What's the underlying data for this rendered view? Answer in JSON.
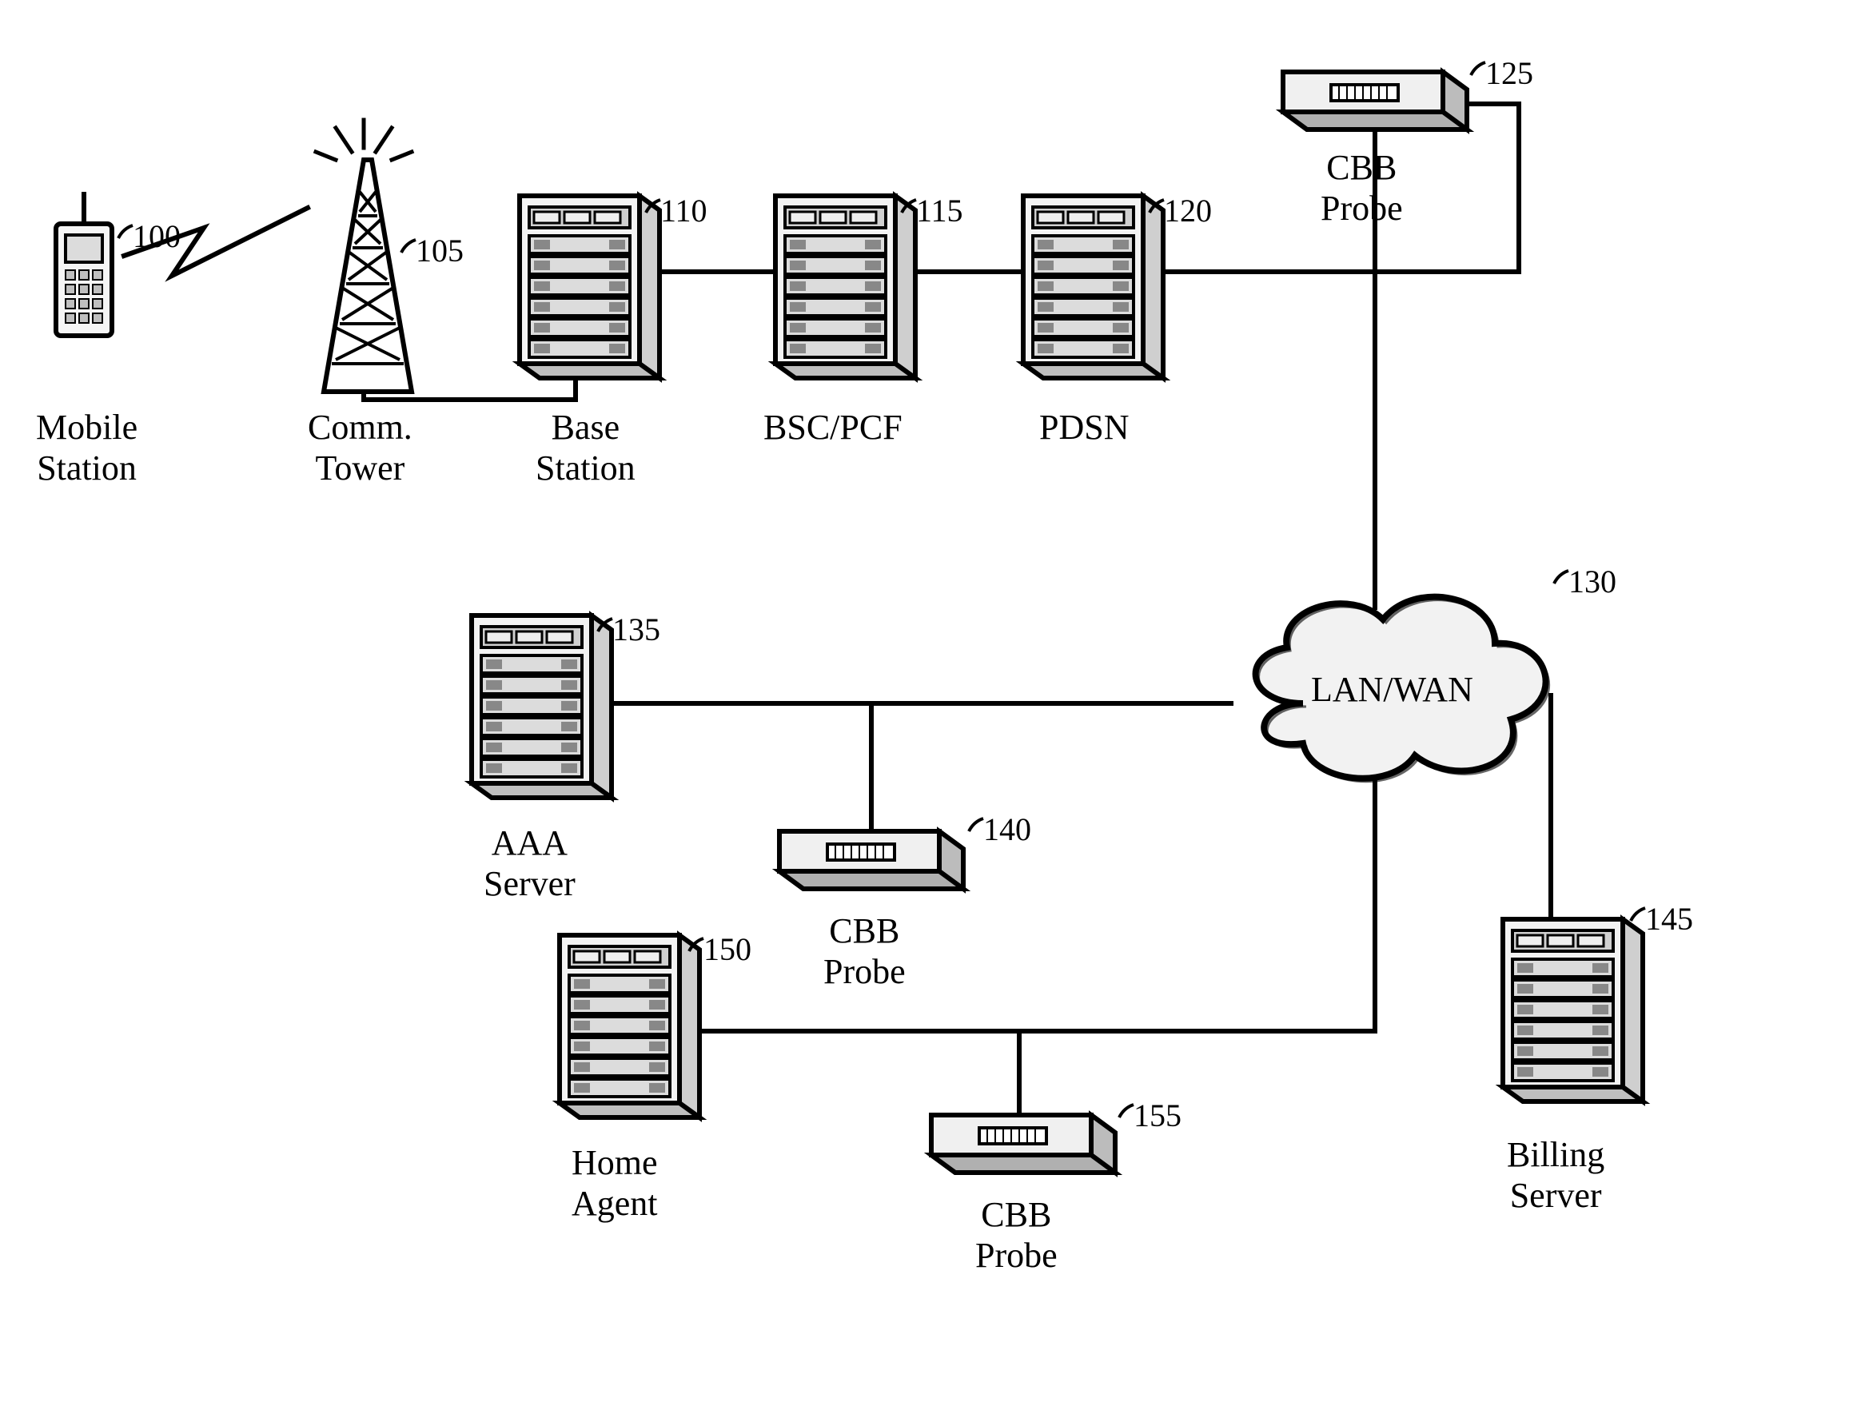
{
  "nodes": {
    "mobile": {
      "ref": "100",
      "label": "Mobile\nStation"
    },
    "tower": {
      "ref": "105",
      "label": "Comm.\nTower"
    },
    "base": {
      "ref": "110",
      "label": "Base\nStation"
    },
    "bsc": {
      "ref": "115",
      "label": "BSC/PCF"
    },
    "pdsn": {
      "ref": "120",
      "label": "PDSN"
    },
    "cbb1": {
      "ref": "125",
      "label": "CBB\nProbe"
    },
    "cloud": {
      "ref": "130",
      "label": "LAN/WAN"
    },
    "aaa": {
      "ref": "135",
      "label": "AAA\nServer"
    },
    "cbb2": {
      "ref": "140",
      "label": "CBB\nProbe"
    },
    "billing": {
      "ref": "145",
      "label": "Billing\nServer"
    },
    "home": {
      "ref": "150",
      "label": "Home\nAgent"
    },
    "cbb3": {
      "ref": "155",
      "label": "CBB\nProbe"
    }
  }
}
